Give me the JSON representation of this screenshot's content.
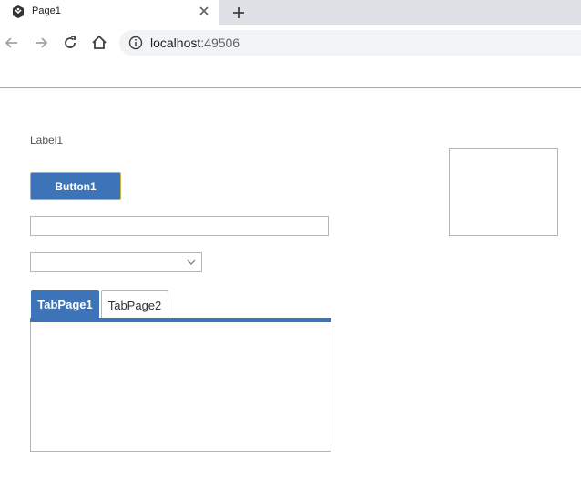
{
  "browser": {
    "tab_title": "Page1",
    "url_host": "localhost",
    "url_port": ":49506"
  },
  "page": {
    "label1": "Label1",
    "button1": "Button1",
    "textbox1_value": "",
    "combobox1_value": "",
    "tabs": [
      {
        "label": "TabPage1",
        "active": true
      },
      {
        "label": "TabPage2",
        "active": false
      }
    ]
  },
  "colors": {
    "accent": "#3d74b8",
    "button_border": "#c9b04a",
    "control_border": "#b5b5b5",
    "tabstrip_bg": "#dee1e6"
  }
}
